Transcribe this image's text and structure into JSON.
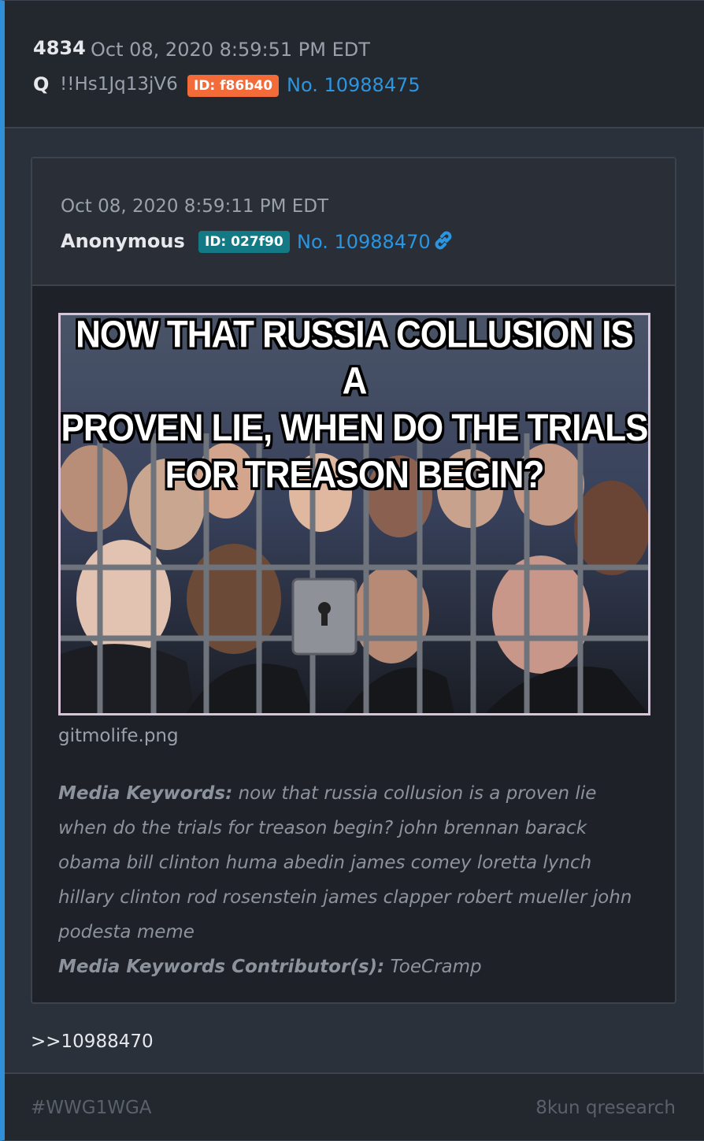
{
  "post": {
    "number": "4834",
    "date": "Oct 08, 2020 8:59:51 PM EDT",
    "name": "Q",
    "tripcode": "!!Hs1Jq13jV6",
    "id_badge": "ID: f86b40",
    "post_no": "No. 10988475"
  },
  "quoted": {
    "date": "Oct 08, 2020 8:59:11 PM EDT",
    "author": "Anonymous",
    "id_badge": "ID: 027f90",
    "post_no": "No. 10988470",
    "link_icon": "link-icon",
    "image": {
      "caption_lines": [
        "NOW THAT RUSSIA COLLUSION IS A",
        "PROVEN LIE, WHEN DO THE TRIALS",
        "FOR TREASON BEGIN?"
      ],
      "filename": "gitmolife.png"
    },
    "keywords_label": "Media Keywords:",
    "keywords": "now that russia collusion is a proven lie when do the trials for treason begin? john brennan barack obama bill clinton huma abedin james comey loretta lynch hillary clinton rod rosenstein james clapper robert mueller john podesta meme",
    "contributors_label": "Media Keywords Contributor(s):",
    "contributors": "ToeCramp"
  },
  "reply_link": ">>10988470",
  "footer": {
    "hashtag": "#WWG1WGA",
    "source": "8kun qresearch"
  },
  "colors": {
    "accent_blue": "#2f8fd8",
    "link_blue": "#2b95e0",
    "badge_orange": "#f26b38",
    "badge_teal": "#137a85"
  }
}
